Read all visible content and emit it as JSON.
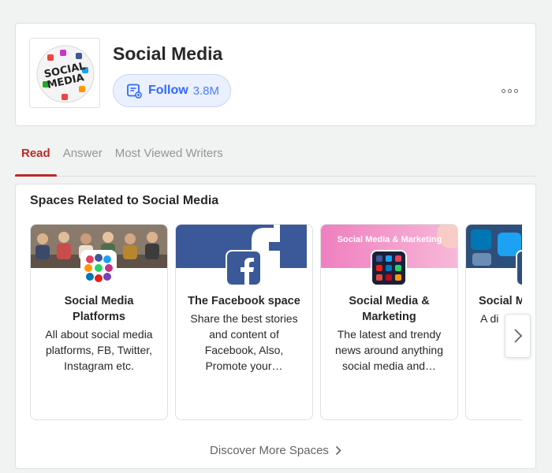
{
  "topic": {
    "title": "Social Media",
    "image_icon": "social-media-globe",
    "follow_label": "Follow",
    "follow_count": "3.8M",
    "more_icon": "ellipsis-icon"
  },
  "tabs": [
    {
      "label": "Read",
      "active": true
    },
    {
      "label": "Answer",
      "active": false
    },
    {
      "label": "Most Viewed Writers",
      "active": false
    }
  ],
  "spaces": {
    "heading": "Spaces Related to Social Media",
    "cards": [
      {
        "name": "Social Media Platforms",
        "description": "All about social media platforms, FB, Twitter, Instagram etc."
      },
      {
        "name": "The Facebook space",
        "description": "Share the best stories and content of Facebook, Also, Promote your…"
      },
      {
        "name": "Social Media & Marketing",
        "cover_text": "Social Media & Marketing",
        "description": "The latest and trendy news around anything social media and…"
      },
      {
        "name": "Social M",
        "description": "A di"
      }
    ],
    "discover_label": "Discover More Spaces"
  },
  "colors": {
    "accent_red": "#b92b27",
    "follow_blue": "#2e69ff",
    "facebook_blue": "#3b5998"
  }
}
